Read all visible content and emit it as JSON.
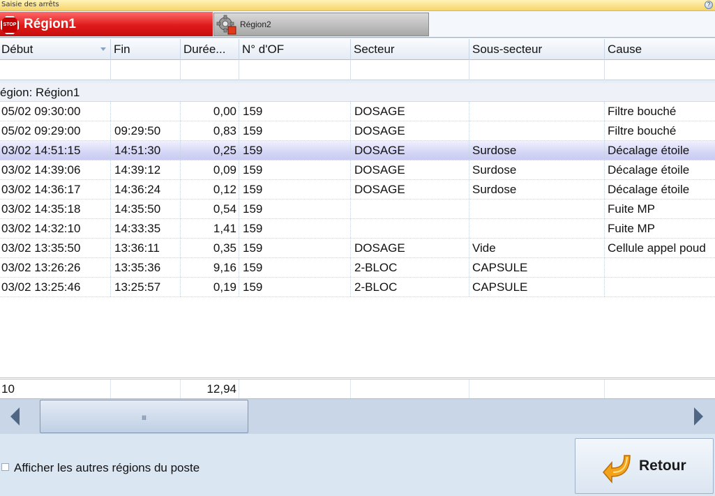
{
  "window": {
    "title": "Saisie des arrêts",
    "help_glyph": "?"
  },
  "tabs": [
    {
      "label": "Région1",
      "icon": "stop-sign-icon",
      "stop_text": "STOP",
      "active": true,
      "color": "#e01a1a"
    },
    {
      "label": "Région2",
      "icon": "gear-warning-icon",
      "active": false
    }
  ],
  "grid": {
    "columns": [
      "Début",
      "Fin",
      "Durée...",
      "N° d'OF",
      "Secteur",
      "Sous-secteur",
      "Cause"
    ],
    "group_label": "égion:  Région1",
    "rows": [
      {
        "debut": "05/02 09:30:00",
        "fin": "",
        "duree": "0,00",
        "of": "159",
        "secteur": "DOSAGE",
        "sous_secteur": "",
        "cause": "Filtre bouché",
        "selected": false
      },
      {
        "debut": "05/02 09:29:00",
        "fin": "09:29:50",
        "duree": "0,83",
        "of": "159",
        "secteur": "DOSAGE",
        "sous_secteur": "",
        "cause": "Filtre bouché",
        "selected": false
      },
      {
        "debut": "03/02 14:51:15",
        "fin": "14:51:30",
        "duree": "0,25",
        "of": "159",
        "secteur": "DOSAGE",
        "sous_secteur": "Surdose",
        "cause": "Décalage étoile",
        "selected": true
      },
      {
        "debut": "03/02 14:39:06",
        "fin": "14:39:12",
        "duree": "0,09",
        "of": "159",
        "secteur": "DOSAGE",
        "sous_secteur": "Surdose",
        "cause": "Décalage étoile",
        "selected": false
      },
      {
        "debut": "03/02 14:36:17",
        "fin": "14:36:24",
        "duree": "0,12",
        "of": "159",
        "secteur": "DOSAGE",
        "sous_secteur": "Surdose",
        "cause": "Décalage étoile",
        "selected": false
      },
      {
        "debut": "03/02 14:35:18",
        "fin": "14:35:50",
        "duree": "0,54",
        "of": "159",
        "secteur": "",
        "sous_secteur": "",
        "cause": "Fuite MP",
        "selected": false
      },
      {
        "debut": "03/02 14:32:10",
        "fin": "14:33:35",
        "duree": "1,41",
        "of": "159",
        "secteur": "",
        "sous_secteur": "",
        "cause": "Fuite MP",
        "selected": false
      },
      {
        "debut": "03/02 13:35:50",
        "fin": "13:36:11",
        "duree": "0,35",
        "of": "159",
        "secteur": "DOSAGE",
        "sous_secteur": "Vide",
        "cause": "Cellule appel poud",
        "selected": false
      },
      {
        "debut": "03/02 13:26:26",
        "fin": "13:35:36",
        "duree": "9,16",
        "of": "159",
        "secteur": "2-BLOC",
        "sous_secteur": "CAPSULE",
        "cause": "",
        "selected": false
      },
      {
        "debut": "03/02 13:25:46",
        "fin": "13:25:57",
        "duree": "0,19",
        "of": "159",
        "secteur": "2-BLOC",
        "sous_secteur": "CAPSULE",
        "cause": "",
        "selected": false
      }
    ],
    "footer": {
      "count": "10",
      "total_duree": "12,94"
    }
  },
  "scrollbar": {
    "thumb_grip": "IIII",
    "position": 0.05
  },
  "bottom": {
    "checkbox_label": "Afficher les autres régions du poste",
    "checkbox_checked": false,
    "retour_label": "Retour",
    "retour_icon": "return-arrow-icon"
  },
  "colors": {
    "accent_tab": "#e01a1a",
    "selected_row": "#d5d6f6",
    "background": "#dbe6f3"
  }
}
